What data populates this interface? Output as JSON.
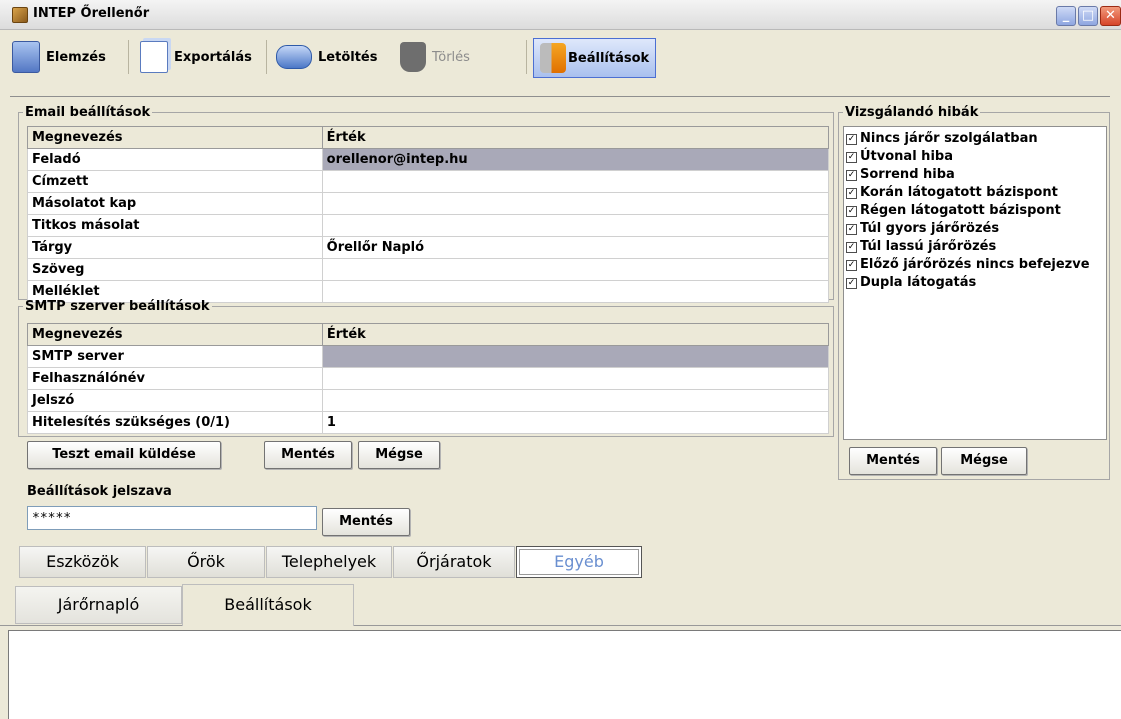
{
  "window": {
    "title": "INTEP Őrellenőr"
  },
  "toolbar": {
    "elemzes": "Elemzés",
    "exportalas": "Exportálás",
    "letoltes": "Letöltés",
    "torles": "Törlés",
    "beallitasok": "Beállítások"
  },
  "email": {
    "legend": "Email beállítások",
    "col_name": "Megnevezés",
    "col_value": "Érték",
    "rows": [
      {
        "key": "Feladó",
        "value": "orellenor@intep.hu"
      },
      {
        "key": "Címzett",
        "value": ""
      },
      {
        "key": "Másolatot kap",
        "value": ""
      },
      {
        "key": "Titkos másolat",
        "value": ""
      },
      {
        "key": "Tárgy",
        "value": "Őrellőr Napló"
      },
      {
        "key": "Szöveg",
        "value": ""
      },
      {
        "key": "Melléklet",
        "value": ""
      }
    ]
  },
  "smtp": {
    "legend": "SMTP szerver beállítások",
    "col_name": "Megnevezés",
    "col_value": "Érték",
    "rows": [
      {
        "key": "SMTP server",
        "value": ""
      },
      {
        "key": "Felhasználónév",
        "value": ""
      },
      {
        "key": "Jelszó",
        "value": ""
      },
      {
        "key": "Hitelesítés szükséges (0/1)",
        "value": "1"
      }
    ],
    "test_button": "Teszt email küldése",
    "save_button": "Mentés",
    "cancel_button": "Mégse"
  },
  "password": {
    "label": "Beállítások jelszava",
    "value": "*****",
    "save_button": "Mentés"
  },
  "errors": {
    "legend": "Vizsgálandó hibák",
    "items": [
      "Nincs járőr szolgálatban",
      "Útvonal hiba",
      "Sorrend hiba",
      "Korán látogatott bázispont",
      "Régen látogatott bázispont",
      "Túl gyors járőrözés",
      "Túl lassú járőrözés",
      "Előző járőrözés nincs befejezve",
      "Dupla látogatás"
    ],
    "save_button": "Mentés",
    "cancel_button": "Mégse"
  },
  "tabs_row1": [
    "Eszközök",
    "Őrök",
    "Telephelyek",
    "Őrjáratok",
    "Egyéb"
  ],
  "tabs_row2": [
    "Járőrnapló",
    "Beállítások"
  ]
}
